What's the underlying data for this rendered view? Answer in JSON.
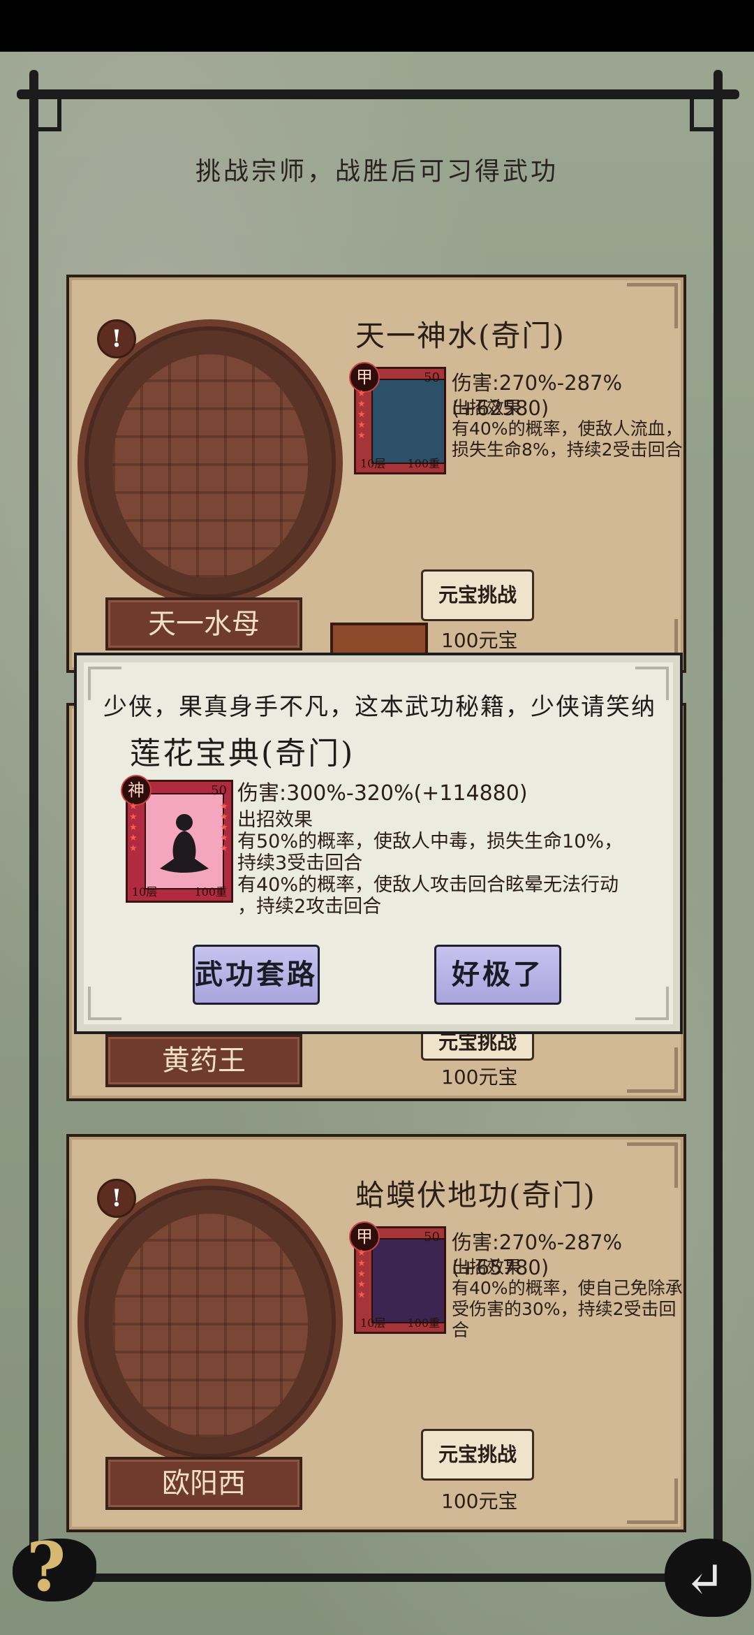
{
  "header": {
    "text": "挑战宗师，战胜后可习得武功"
  },
  "cards": [
    {
      "name": "天一水母",
      "skill_title": "天一神水(奇门)",
      "grade": "甲",
      "level": "50",
      "layer": "10层",
      "weight": "100重",
      "damage": "伤害:270%-287%(+62580)",
      "effect_label": "出招效果",
      "effect_text": "有40%的概率，使敌人流血，损失生命8%，持续2受击回合",
      "button": "元宝挑战",
      "cost": "100元宝"
    },
    {
      "name": "黄药王",
      "button": "元宝挑战",
      "cost": "100元宝"
    },
    {
      "name": "欧阳西",
      "skill_title": "蛤蟆伏地功(奇门)",
      "grade": "甲",
      "level": "50",
      "layer": "10层",
      "weight": "100重",
      "damage": "伤害:270%-287%(+65780)",
      "effect_label": "出招效果",
      "effect_text": "有40%的概率，使自己免除承受伤害的30%，持续2受击回合",
      "button": "元宝挑战",
      "cost": "100元宝"
    }
  ],
  "modal": {
    "message": "少侠，果真身手不凡，这本武功秘籍，少侠请笑纳",
    "title": "莲花宝典(奇门)",
    "grade": "神",
    "level": "50",
    "layer": "10层",
    "weight": "100重",
    "damage": "伤害:300%-320%(+114880)",
    "effect_label": "出招效果",
    "effect_line1": "有50%的概率，使敌人中毒，损失生命10%，",
    "effect_line2": "持续3受击回合",
    "effect_line3": "有40%的概率，使敌人攻击回合眩晕无法行动",
    "effect_line4": "，持续2攻击回合",
    "btn_left": "武功套路",
    "btn_right": "好极了"
  },
  "help_label": "?",
  "colors": {
    "card_bg": "#d1b995",
    "name_plate": "#6e3b2d",
    "modal_btn": "#b9b5e8"
  }
}
